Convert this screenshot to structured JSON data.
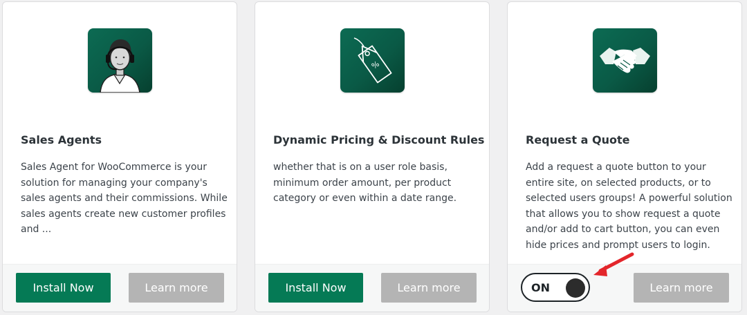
{
  "cards": [
    {
      "icon": "support-agent-icon",
      "title": "Sales Agents",
      "description": "Sales Agent for WooCommerce is your solution for managing your company's sales agents and their commissions. While sales agents create new customer profiles and ...",
      "primary_button": "Install Now",
      "secondary_button": "Learn more"
    },
    {
      "icon": "discount-tag-icon",
      "title": "Dynamic Pricing & Discount Rules",
      "description": "whether that is on a user role basis, minimum order amount, per product category or even within a date range.",
      "primary_button": "Install Now",
      "secondary_button": "Learn more"
    },
    {
      "icon": "handshake-icon",
      "title": "Request a Quote",
      "description": "Add a request a quote button to your entire site, on selected products, or to selected users groups! A powerful solution that allows you to show request a quote and/or add to cart button, you can even hide prices and prompt users to login.",
      "toggle_label": "ON",
      "secondary_button": "Learn more"
    }
  ],
  "colors": {
    "icon_tile": "#0a5a46",
    "install_button": "#057a55",
    "learn_button": "#b4b4b4",
    "annotation_arrow": "#e3262b"
  }
}
